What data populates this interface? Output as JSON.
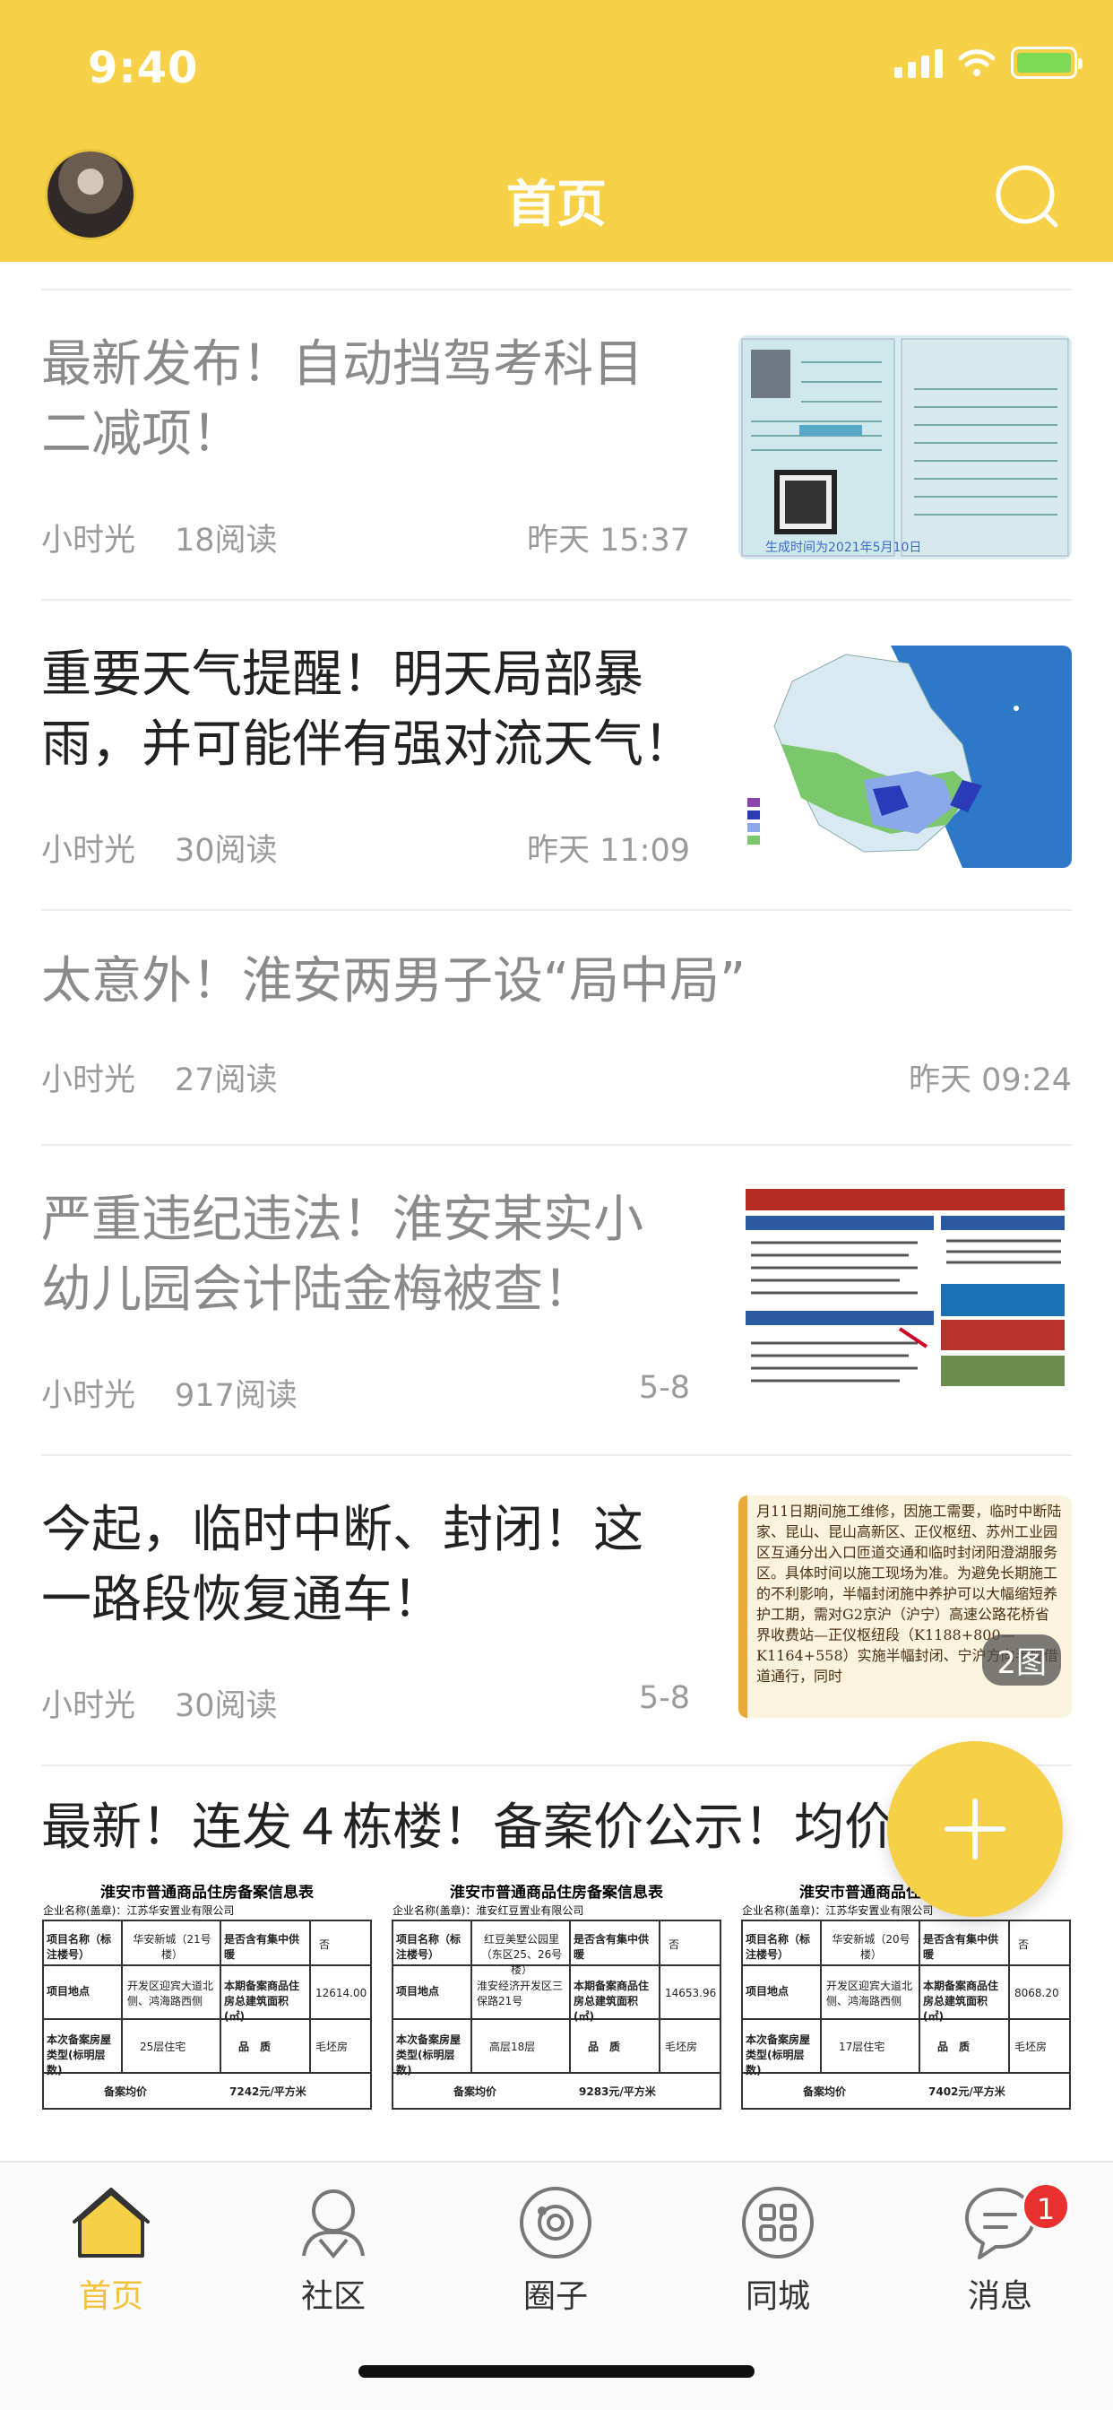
{
  "status_bar": {
    "time": "9:40"
  },
  "header": {
    "title": "首页"
  },
  "articles": [
    {
      "title_line1": "最新发布！自动挡驾考科目",
      "title_line2": "二减项！",
      "author": "小时光",
      "reads": "18阅读",
      "time": "昨天 15:37",
      "thumb_caption": "生成时间为2021年5月10日"
    },
    {
      "title_line1": "重要天气提醒！明天局部暴",
      "title_line2": "雨，并可能伴有强对流天气！",
      "author": "小时光",
      "reads": "30阅读",
      "time": "昨天 11:09"
    },
    {
      "title_line1": "太意外！淮安两男子设“局中局”",
      "author": "小时光",
      "reads": "27阅读",
      "time": "昨天 09:24"
    },
    {
      "title_line1": "严重违纪违法！淮安某实小",
      "title_line2": "幼儿园会计陆金梅被查！",
      "author": "小时光",
      "reads": "917阅读",
      "time": "5-8"
    },
    {
      "title_line1": "今起，临时中断、封闭！这",
      "title_line2": "一路段恢复通车！",
      "author": "小时光",
      "reads": "30阅读",
      "time": "5-8",
      "image_count": "2图",
      "notice_text": "月11日期间施工维修，因施工需要，临时中断陆家、昆山、昆山高新区、正仪枢纽、苏州工业园区互通分出入口匝道交通和临时封闭阳澄湖服务区。具体时间以施工现场为准。为避免长期施工的不利影响，半幅封闭施中养护可以大幅缩短养护工期，需对G2京沪（沪宁）高速公路花桥省界收费站—正仪枢纽段（K1188+800—K1164+558）实施半幅封闭、宁沪方向半幅借道通行，同时"
    },
    {
      "title_line1": "最新！连发４栋楼！备案价公示！均价",
      "docs": [
        {
          "heading": "淮安市普通商品住房备案信息表",
          "company": "企业名称(盖章)：江苏华安置业有限公司",
          "project": "华安新城（21号楼）",
          "heating": "否",
          "location": "开发区迎宾大道北侧、鸿海路西侧",
          "area": "12614.00",
          "floors": "25层住宅",
          "quality": "毛坯房",
          "price": "7242元/平方米"
        },
        {
          "heading": "淮安市普通商品住房备案信息表",
          "company": "企业名称(盖章)：淮安红豆置业有限公司",
          "project": "红豆美墅公园里（东区25、26号楼）",
          "heating": "否",
          "location": "淮安经济开发区三保路21号",
          "area": "14653.96",
          "floors": "高层18层",
          "quality": "毛坯房",
          "price": "9283元/平方米"
        },
        {
          "heading": "淮安市普通商品住房备案信息表",
          "company": "企业名称(盖章)：江苏华安置业有限公司",
          "project": "华安新城（20号楼）",
          "heating": "否",
          "location": "开发区迎宾大道北侧、鸿海路西侧",
          "area": "8068.20",
          "floors": "17层住宅",
          "quality": "毛坯房",
          "price": "7402元/平方米"
        }
      ],
      "doc_labels": {
        "project": "项目名称（标注楼号）",
        "heating": "是否含有集中供暖",
        "location": "项目地点",
        "area": "本期备案商品住房总建筑面积(㎡)",
        "floors": "本次备案房屋类型(标明层数)",
        "quality": "品　质",
        "price": "备案均价"
      }
    }
  ],
  "tabbar": {
    "items": [
      {
        "label": "首页",
        "icon": "home-icon",
        "active": true
      },
      {
        "label": "社区",
        "icon": "community-icon"
      },
      {
        "label": "圈子",
        "icon": "circle-icon"
      },
      {
        "label": "同城",
        "icon": "city-icon"
      },
      {
        "label": "消息",
        "icon": "message-icon",
        "badge": "1"
      }
    ]
  },
  "colors": {
    "brand_yellow": "#f6d047",
    "active_tab": "#f3c23a",
    "badge_red": "#e8312f"
  }
}
